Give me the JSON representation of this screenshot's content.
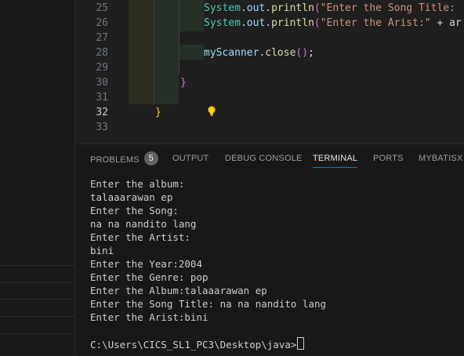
{
  "editor": {
    "lines": [
      {
        "number": "25",
        "tokens": [
          {
            "t": "System",
            "c": "tok-class"
          },
          {
            "t": ".",
            "c": "tok-punc"
          },
          {
            "t": "out",
            "c": "tok-var"
          },
          {
            "t": ".",
            "c": "tok-punc"
          },
          {
            "t": "println",
            "c": "tok-fn"
          },
          {
            "t": "(",
            "c": "tok-brace1"
          },
          {
            "t": "\"Enter the Song Title: ",
            "c": "tok-str"
          }
        ]
      },
      {
        "number": "26",
        "tokens": [
          {
            "t": "System",
            "c": "tok-class"
          },
          {
            "t": ".",
            "c": "tok-punc"
          },
          {
            "t": "out",
            "c": "tok-var"
          },
          {
            "t": ".",
            "c": "tok-punc"
          },
          {
            "t": "println",
            "c": "tok-fn"
          },
          {
            "t": "(",
            "c": "tok-brace1"
          },
          {
            "t": "\"Enter the Arist:\"",
            "c": "tok-str"
          },
          {
            "t": " + ar",
            "c": "tok-punc"
          }
        ]
      },
      {
        "number": "27",
        "tokens": []
      },
      {
        "number": "28",
        "tokens": [
          {
            "t": "myScanner",
            "c": "tok-var"
          },
          {
            "t": ".",
            "c": "tok-punc"
          },
          {
            "t": "close",
            "c": "tok-fn"
          },
          {
            "t": "()",
            "c": "tok-brace1"
          },
          {
            "t": ";",
            "c": "tok-punc"
          }
        ]
      },
      {
        "number": "29",
        "tokens": []
      },
      {
        "number": "30",
        "tokens": [
          {
            "t": "}",
            "c": "tok-brace1"
          }
        ]
      },
      {
        "number": "31",
        "tokens": []
      },
      {
        "number": "32",
        "tokens": [
          {
            "t": "}",
            "c": "tok-brace2"
          }
        ],
        "active": true
      },
      {
        "number": "33",
        "tokens": []
      }
    ]
  },
  "panel": {
    "tabs": [
      {
        "label": "PROBLEMS",
        "badge": "5"
      },
      {
        "label": "OUTPUT"
      },
      {
        "label": "DEBUG CONSOLE"
      },
      {
        "label": "TERMINAL",
        "active": true
      },
      {
        "label": "PORTS"
      },
      {
        "label": "MYBATISX"
      }
    ],
    "terminal_lines": [
      "Enter the album:",
      "talaaarawan ep",
      "Enter the Song:",
      "na na nandito lang",
      "Enter the Artist:",
      "bini",
      "Enter the Year:2004",
      "Enter the Genre: pop",
      "Enter the Album:talaaarawan ep",
      "Enter the Song Title: na na nandito lang",
      "Enter the Arist:bini",
      "",
      "C:\\Users\\CICS_SL1_PC3\\Desktop\\java>"
    ]
  },
  "colors": {
    "accent": "#0078d4",
    "background": "#1f1f1f",
    "panel_background": "#181818"
  }
}
